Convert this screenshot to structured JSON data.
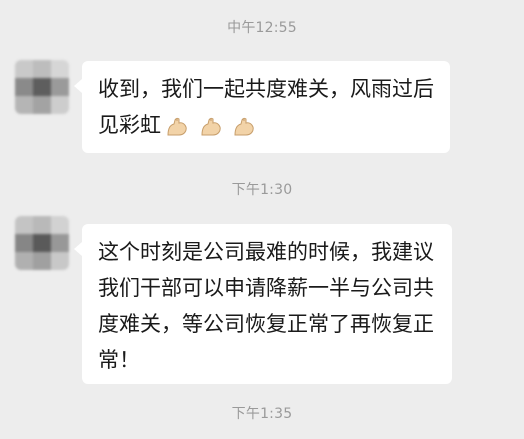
{
  "chat": {
    "timestamps": [
      "中午12:55",
      "下午1:30",
      "下午1:35"
    ],
    "messages": [
      {
        "text": "收到，我们一起共度难关，风雨过后见彩虹",
        "emoji": [
          "flexed-biceps-icon",
          "flexed-biceps-icon",
          "flexed-biceps-icon"
        ]
      },
      {
        "text": "这个时刻是公司最难的时候，我建议我们干部可以申请降薪一半与公司共度难关，等公司恢复正常了再恢复正常！"
      }
    ]
  },
  "colors": {
    "background": "#ededed",
    "bubble": "#ffffff",
    "timestamp": "#9a9a9a",
    "text": "#1a1a1a"
  }
}
